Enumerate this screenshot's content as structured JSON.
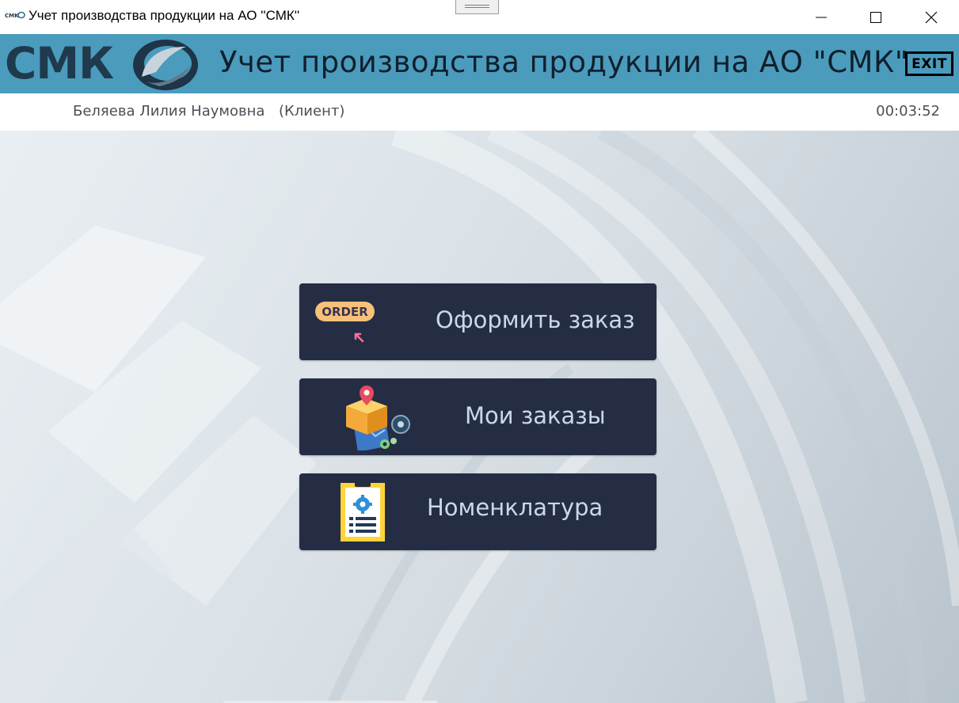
{
  "window": {
    "title": "Учет производства продукции на АО ''СМК''",
    "icon": "smk-app-icon",
    "controls": [
      "minimize-icon",
      "maximize-icon",
      "close-icon"
    ]
  },
  "header": {
    "logo_text": "СМК",
    "title": "Учет производства продукции на АО \"СМК\"",
    "exit_label": "EXIT",
    "background_color": "#4b9bbd"
  },
  "userbar": {
    "user_name": "Беляева Лилия Наумовна",
    "role": "(Клиент)",
    "timer": "00:03:52"
  },
  "menu": {
    "button_color": "#252d45",
    "items": [
      {
        "label": "Оформить заказ",
        "icon": "order-icon",
        "icon_text": "ORDER"
      },
      {
        "label": "Мои заказы",
        "icon": "package-map-icon"
      },
      {
        "label": "Номенклатура",
        "icon": "clipboard-gear-icon"
      }
    ]
  }
}
